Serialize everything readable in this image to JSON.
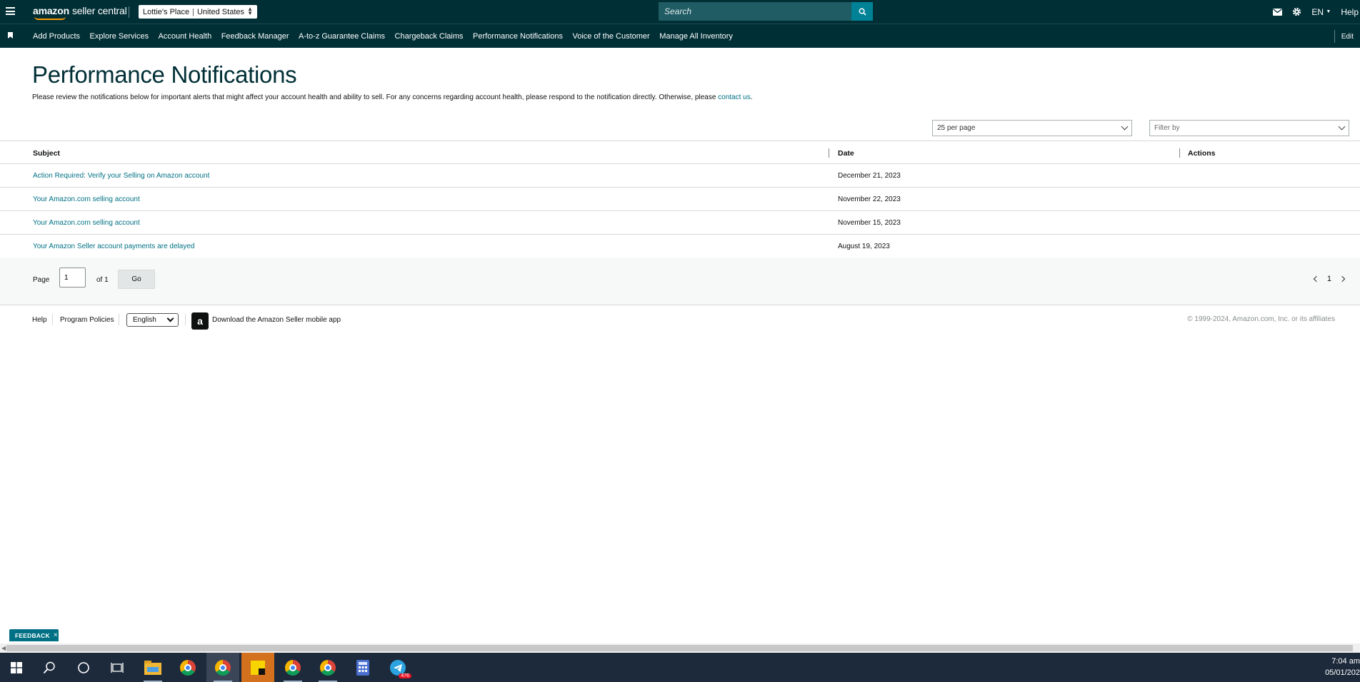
{
  "header": {
    "logo_brand": "amazon",
    "logo_product": "seller central",
    "account_name": "Lottie's Place",
    "account_region": "United States",
    "search_placeholder": "Search",
    "language": "EN",
    "help": "Help"
  },
  "nav": {
    "items": [
      "Add Products",
      "Explore Services",
      "Account Health",
      "Feedback Manager",
      "A-to-z Guarantee Claims",
      "Chargeback Claims",
      "Performance Notifications",
      "Voice of the Customer",
      "Manage All Inventory"
    ],
    "edit": "Edit"
  },
  "page": {
    "title": "Performance Notifications",
    "description": "Please review the notifications below for important alerts that might affect your account health and ability to sell. For any concerns regarding account health, please respond to the notification directly. Otherwise, please ",
    "contact_link": "contact us",
    "description_end": "."
  },
  "controls": {
    "per_page": "25 per page",
    "filter_placeholder": "Filter by"
  },
  "table": {
    "headers": [
      "Subject",
      "Date",
      "Actions"
    ],
    "rows": [
      {
        "subject": "Action Required: Verify your Selling on Amazon account",
        "date": "December 21, 2023"
      },
      {
        "subject": "Your Amazon.com selling account",
        "date": "November 22, 2023"
      },
      {
        "subject": "Your Amazon.com selling account",
        "date": "November 15, 2023"
      },
      {
        "subject": "Your Amazon Seller account payments are delayed",
        "date": "August 19, 2023"
      }
    ]
  },
  "pagination": {
    "page_label": "Page",
    "page_value": "1",
    "of_label": "of 1",
    "go": "Go",
    "current": "1"
  },
  "footer": {
    "help": "Help",
    "program_policies": "Program Policies",
    "language": "English",
    "app_icon_letter": "a",
    "download_app": "Download the Amazon Seller mobile app",
    "copyright": "© 1999-2024, Amazon.com, Inc. or its affiliates"
  },
  "feedback": {
    "label": "FEEDBACK",
    "close": "×"
  },
  "taskbar": {
    "time": "7:04 am",
    "date": "05/01/202",
    "telegram_badge": "476"
  },
  "colors": {
    "header_bg": "#002f36",
    "link": "#007185",
    "search_button": "#008296",
    "taskbar_bg": "#1d2a3c"
  }
}
